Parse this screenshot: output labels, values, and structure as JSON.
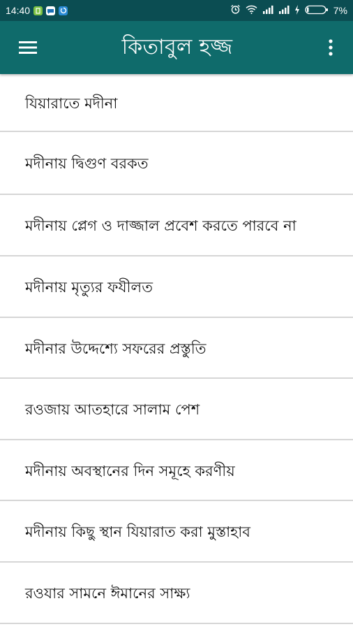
{
  "status_bar": {
    "time": "14:40",
    "battery_percent": "7%"
  },
  "app_bar": {
    "title": "কিতাবুল হজ্জ",
    "menu_icon": "hamburger-menu-icon",
    "overflow_icon": "more-vertical-icon"
  },
  "list": {
    "items": [
      {
        "label": "যিয়ারাতে মদীনা"
      },
      {
        "label": "মদীনায় দ্বিগুণ বরকত"
      },
      {
        "label": "মদীনায় প্লেগ ও দাজ্জাল প্রবেশ করতে পারবে না"
      },
      {
        "label": "মদীনায় মৃত্যুর ফযীলত"
      },
      {
        "label": "মদীনার উদ্দেশ্যে সফরের প্রস্তুতি"
      },
      {
        "label": "রওজায় আতহারে সালাম পেশ"
      },
      {
        "label": "মদীনায় অবস্থানের দিন সমূহে করণীয়"
      },
      {
        "label": "মদীনায় কিছু স্থান যিয়ারাত করা মুস্তাহাব"
      },
      {
        "label": "রওযার সামনে ঈমানের সাক্ষ্য"
      }
    ]
  },
  "colors": {
    "status_bar_bg": "#0b4d52",
    "app_bar_bg": "#0f6b6b",
    "divider": "#d6d6d6"
  }
}
